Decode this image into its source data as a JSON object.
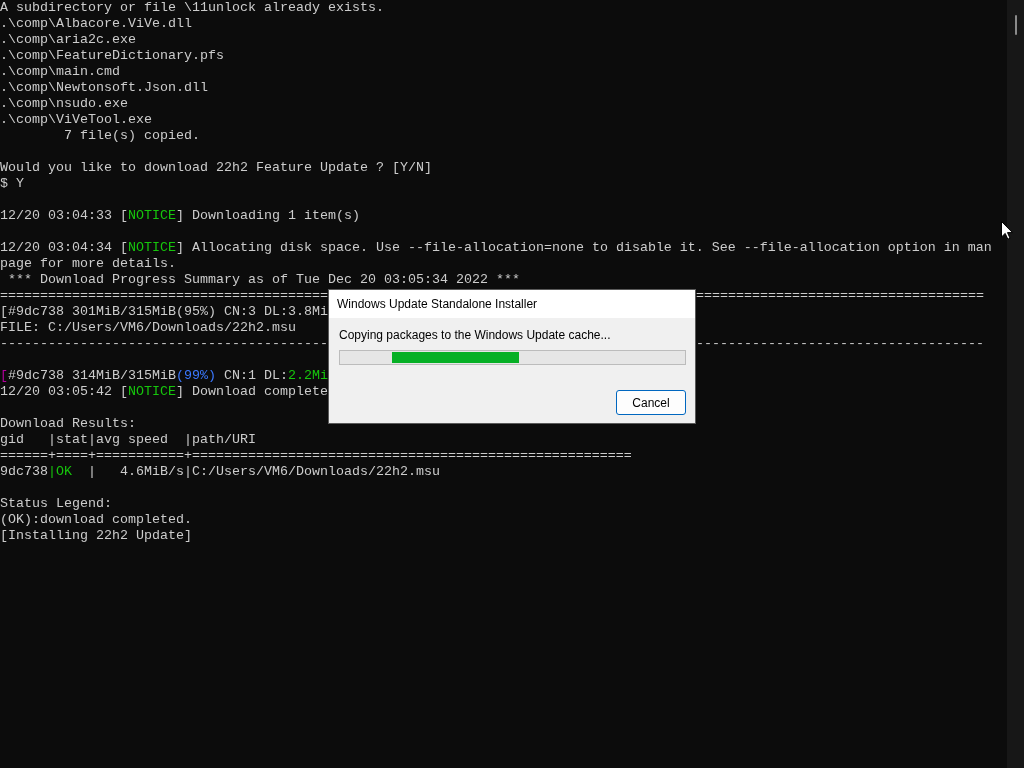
{
  "console": {
    "lines": [
      {
        "segments": [
          {
            "text": "A subdirectory or file \\11unlock already exists."
          }
        ]
      },
      {
        "segments": [
          {
            "text": ".\\comp\\Albacore.ViVe.dll"
          }
        ]
      },
      {
        "segments": [
          {
            "text": ".\\comp\\aria2c.exe"
          }
        ]
      },
      {
        "segments": [
          {
            "text": ".\\comp\\FeatureDictionary.pfs"
          }
        ]
      },
      {
        "segments": [
          {
            "text": ".\\comp\\main.cmd"
          }
        ]
      },
      {
        "segments": [
          {
            "text": ".\\comp\\Newtonsoft.Json.dll"
          }
        ]
      },
      {
        "segments": [
          {
            "text": ".\\comp\\nsudo.exe"
          }
        ]
      },
      {
        "segments": [
          {
            "text": ".\\comp\\ViVeTool.exe"
          }
        ]
      },
      {
        "segments": [
          {
            "text": "        7 file(s) copied."
          }
        ]
      },
      {
        "blank_before": true,
        "segments": [
          {
            "text": "Would you like to download 22h2 Feature Update ? [Y/N]"
          }
        ]
      },
      {
        "segments": [
          {
            "text": "$ Y"
          }
        ]
      },
      {
        "blank_before": true,
        "segments": [
          {
            "text": "12/20 03:04:33 ["
          },
          {
            "text": "NOTICE",
            "color": "#16c60c"
          },
          {
            "text": "] Downloading 1 item(s)"
          }
        ]
      },
      {
        "blank_before": true,
        "segments": [
          {
            "text": "12/20 03:04:34 ["
          },
          {
            "text": "NOTICE",
            "color": "#16c60c"
          },
          {
            "text": "] Allocating disk space. Use --file-allocation=none to disable it. See --file-allocation option in man"
          }
        ]
      },
      {
        "segments": [
          {
            "text": "page for more details."
          }
        ]
      },
      {
        "segments": [
          {
            "text": " *** Download Progress Summary as of Tue Dec 20 03:05:34 2022 ***"
          }
        ]
      },
      {
        "segments": [
          {
            "text": "========================================="
          }
        ],
        "right": "===================================="
      },
      {
        "segments": [
          {
            "text": "[#9dc738 301MiB/315MiB(95%) CN:3 DL:3.8Mi"
          }
        ]
      },
      {
        "segments": [
          {
            "text": "FILE: C:/Users/VM6/Downloads/22h2.msu"
          }
        ]
      },
      {
        "segments": [
          {
            "text": "-----------------------------------------"
          }
        ],
        "right": "------------------------------------"
      },
      {
        "blank_before": true,
        "segments": [
          {
            "text": "[",
            "color": "#b4009e"
          },
          {
            "text": "#9dc738 314MiB/315MiB"
          },
          {
            "text": "(99%)",
            "color": "#3b78ff"
          },
          {
            "text": " CN:1 DL:"
          },
          {
            "text": "2.2Mi",
            "color": "#16c60c"
          }
        ]
      },
      {
        "segments": [
          {
            "text": "12/20 03:05:42 ["
          },
          {
            "text": "NOTICE",
            "color": "#16c60c"
          },
          {
            "text": "] Download complete"
          }
        ]
      },
      {
        "blank_before": true,
        "segments": [
          {
            "text": "Download Results:"
          }
        ]
      },
      {
        "segments": [
          {
            "text": "gid   |stat|avg speed  |path/URI"
          }
        ]
      },
      {
        "segments": [
          {
            "text": "======+====+===========+======================================================="
          }
        ]
      },
      {
        "segments": [
          {
            "text": "9dc738"
          },
          {
            "text": "|OK",
            "color": "#16c60c"
          },
          {
            "text": "  |   4.6MiB/s|C:/Users/VM6/Downloads/22h2.msu"
          }
        ]
      },
      {
        "blank_before": true,
        "segments": [
          {
            "text": "Status Legend:"
          }
        ]
      },
      {
        "segments": [
          {
            "text": "(OK):download completed."
          }
        ]
      },
      {
        "segments": [
          {
            "text": "[Installing 22h2 Update]"
          }
        ]
      }
    ]
  },
  "dialog": {
    "title": "Windows Update Standalone Installer",
    "message": "Copying packages to the Windows Update cache...",
    "progress": {
      "level": 0.37
    },
    "buttons": [
      "Cancel"
    ]
  }
}
